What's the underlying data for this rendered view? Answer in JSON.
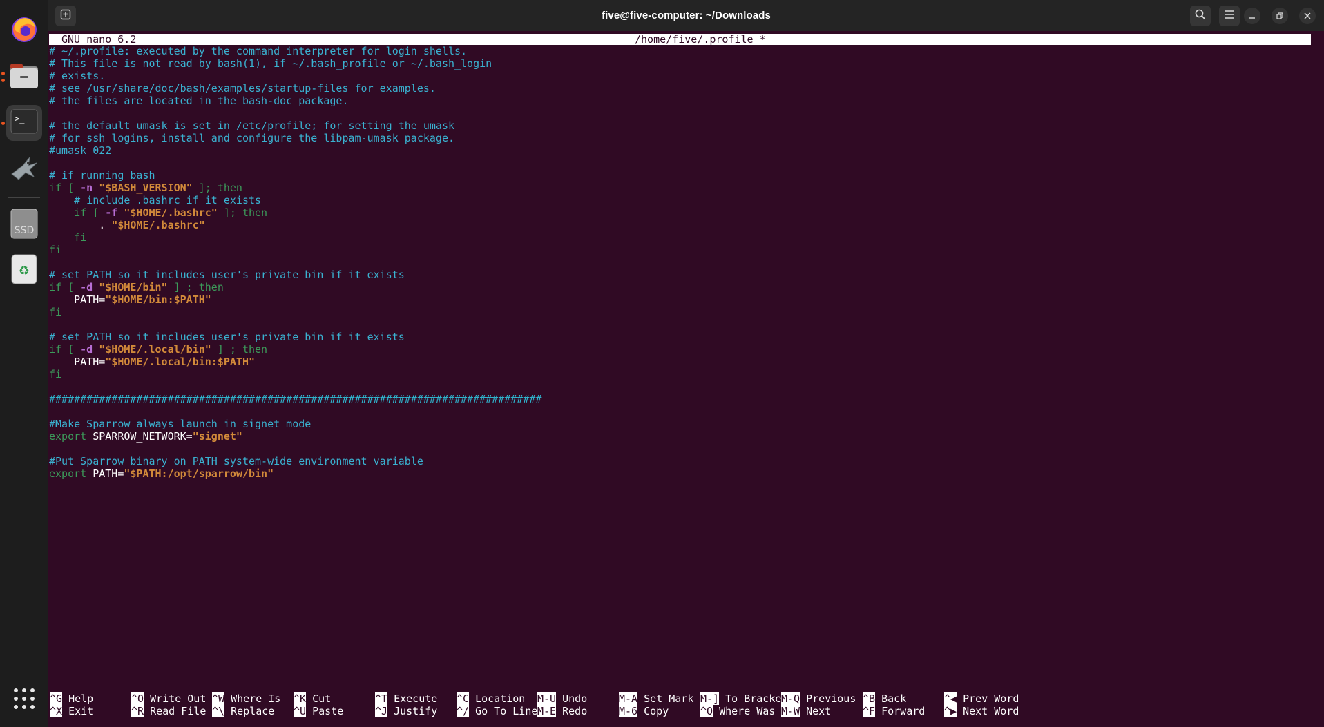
{
  "window": {
    "title": "five@five-computer: ~/Downloads"
  },
  "dock": {
    "items": [
      {
        "name": "firefox-icon",
        "running": false
      },
      {
        "name": "files-icon",
        "running": true
      },
      {
        "name": "terminal-icon",
        "running": true
      },
      {
        "name": "sparrow-icon",
        "running": false
      },
      {
        "name": "ssd-drive-icon",
        "label": "SSD"
      },
      {
        "name": "trash-icon"
      }
    ],
    "show_apps": "apps-grid-icon"
  },
  "nano": {
    "version": "GNU nano 6.2",
    "filename": "/home/five/.profile *"
  },
  "editor": {
    "lines": [
      [
        {
          "t": "# ~/.profile: executed by the command interpreter for login shells.",
          "c": "com"
        }
      ],
      [
        {
          "t": "# This file is not read by bash(1), if ~/.bash_profile or ~/.bash_login",
          "c": "com"
        }
      ],
      [
        {
          "t": "# exists.",
          "c": "com"
        }
      ],
      [
        {
          "t": "# see /usr/share/doc/bash/examples/startup-files for examples.",
          "c": "com"
        }
      ],
      [
        {
          "t": "# the files are located in the bash-doc package.",
          "c": "com"
        }
      ],
      [],
      [
        {
          "t": "# the default umask is set in /etc/profile; for setting the umask",
          "c": "com"
        }
      ],
      [
        {
          "t": "# for ssh logins, install and configure the libpam-umask package.",
          "c": "com"
        }
      ],
      [
        {
          "t": "#umask 022",
          "c": "com"
        }
      ],
      [],
      [
        {
          "t": "# if running bash",
          "c": "com"
        }
      ],
      [
        {
          "t": "if [ ",
          "c": "kw"
        },
        {
          "t": "-n",
          "c": "opt"
        },
        {
          "t": " ",
          "c": ""
        },
        {
          "t": "\"$BASH_VERSION\"",
          "c": "str"
        },
        {
          "t": " ]; then",
          "c": "kw"
        }
      ],
      [
        {
          "t": "    # include .bashrc if it exists",
          "c": "com"
        }
      ],
      [
        {
          "t": "    if [ ",
          "c": "kw"
        },
        {
          "t": "-f",
          "c": "opt"
        },
        {
          "t": " ",
          "c": ""
        },
        {
          "t": "\"$HOME/.bashrc\"",
          "c": "str"
        },
        {
          "t": " ]; then",
          "c": "kw"
        }
      ],
      [
        {
          "t": "        . ",
          "c": ""
        },
        {
          "t": "\"$HOME/.bashrc\"",
          "c": "str"
        }
      ],
      [
        {
          "t": "    fi",
          "c": "kw"
        }
      ],
      [
        {
          "t": "fi",
          "c": "kw"
        }
      ],
      [],
      [
        {
          "t": "# set PATH so it includes user's private bin if it exists",
          "c": "com"
        }
      ],
      [
        {
          "t": "if [ ",
          "c": "kw"
        },
        {
          "t": "-d",
          "c": "opt"
        },
        {
          "t": " ",
          "c": ""
        },
        {
          "t": "\"$HOME/bin\"",
          "c": "str"
        },
        {
          "t": " ] ; then",
          "c": "kw"
        }
      ],
      [
        {
          "t": "    PATH=",
          "c": ""
        },
        {
          "t": "\"$HOME/bin:$PATH\"",
          "c": "str"
        }
      ],
      [
        {
          "t": "fi",
          "c": "kw"
        }
      ],
      [],
      [
        {
          "t": "# set PATH so it includes user's private bin if it exists",
          "c": "com"
        }
      ],
      [
        {
          "t": "if [ ",
          "c": "kw"
        },
        {
          "t": "-d",
          "c": "opt"
        },
        {
          "t": " ",
          "c": ""
        },
        {
          "t": "\"$HOME/.local/bin\"",
          "c": "str"
        },
        {
          "t": " ] ; then",
          "c": "kw"
        }
      ],
      [
        {
          "t": "    PATH=",
          "c": ""
        },
        {
          "t": "\"$HOME/.local/bin:$PATH\"",
          "c": "str"
        }
      ],
      [
        {
          "t": "fi",
          "c": "kw"
        }
      ],
      [],
      [
        {
          "t": "###############################################################################",
          "c": "hash"
        }
      ],
      [],
      [
        {
          "t": "#Make Sparrow always launch in signet mode",
          "c": "com"
        }
      ],
      [
        {
          "t": "export",
          "c": "kw"
        },
        {
          "t": " SPARROW_NETWORK=",
          "c": ""
        },
        {
          "t": "\"signet\"",
          "c": "str"
        }
      ],
      [],
      [
        {
          "t": "#Put Sparrow binary on PATH system-wide environment variable",
          "c": "com"
        }
      ],
      [
        {
          "t": "export",
          "c": "kw"
        },
        {
          "t": " PATH=",
          "c": ""
        },
        {
          "t": "\"$PATH:/opt/sparrow/bin\"",
          "c": "str"
        }
      ]
    ]
  },
  "shortcuts": [
    {
      "key": "^G",
      "label": "Help"
    },
    {
      "key": "^X",
      "label": "Exit"
    },
    {
      "key": "^O",
      "label": "Write Out"
    },
    {
      "key": "^R",
      "label": "Read File"
    },
    {
      "key": "^W",
      "label": "Where Is"
    },
    {
      "key": "^\\",
      "label": "Replace"
    },
    {
      "key": "^K",
      "label": "Cut"
    },
    {
      "key": "^U",
      "label": "Paste"
    },
    {
      "key": "^T",
      "label": "Execute"
    },
    {
      "key": "^J",
      "label": "Justify"
    },
    {
      "key": "^C",
      "label": "Location"
    },
    {
      "key": "^/",
      "label": "Go To Line"
    },
    {
      "key": "M-U",
      "label": "Undo"
    },
    {
      "key": "M-E",
      "label": "Redo"
    },
    {
      "key": "M-A",
      "label": "Set Mark"
    },
    {
      "key": "M-6",
      "label": "Copy"
    },
    {
      "key": "M-]",
      "label": "To Bracket"
    },
    {
      "key": "^Q",
      "label": "Where Was"
    },
    {
      "key": "M-Q",
      "label": "Previous"
    },
    {
      "key": "M-W",
      "label": "Next"
    },
    {
      "key": "^B",
      "label": "Back"
    },
    {
      "key": "^F",
      "label": "Forward"
    },
    {
      "key": "^◀",
      "label": "Prev Word"
    },
    {
      "key": "^▶",
      "label": "Next Word"
    }
  ],
  "colors": {
    "terminal_bg": "#300a24",
    "comment": "#3ab1d0",
    "keyword": "#3c9a5a",
    "string": "#d28a3a",
    "option": "#b76ed4",
    "accent": "#e95420"
  }
}
